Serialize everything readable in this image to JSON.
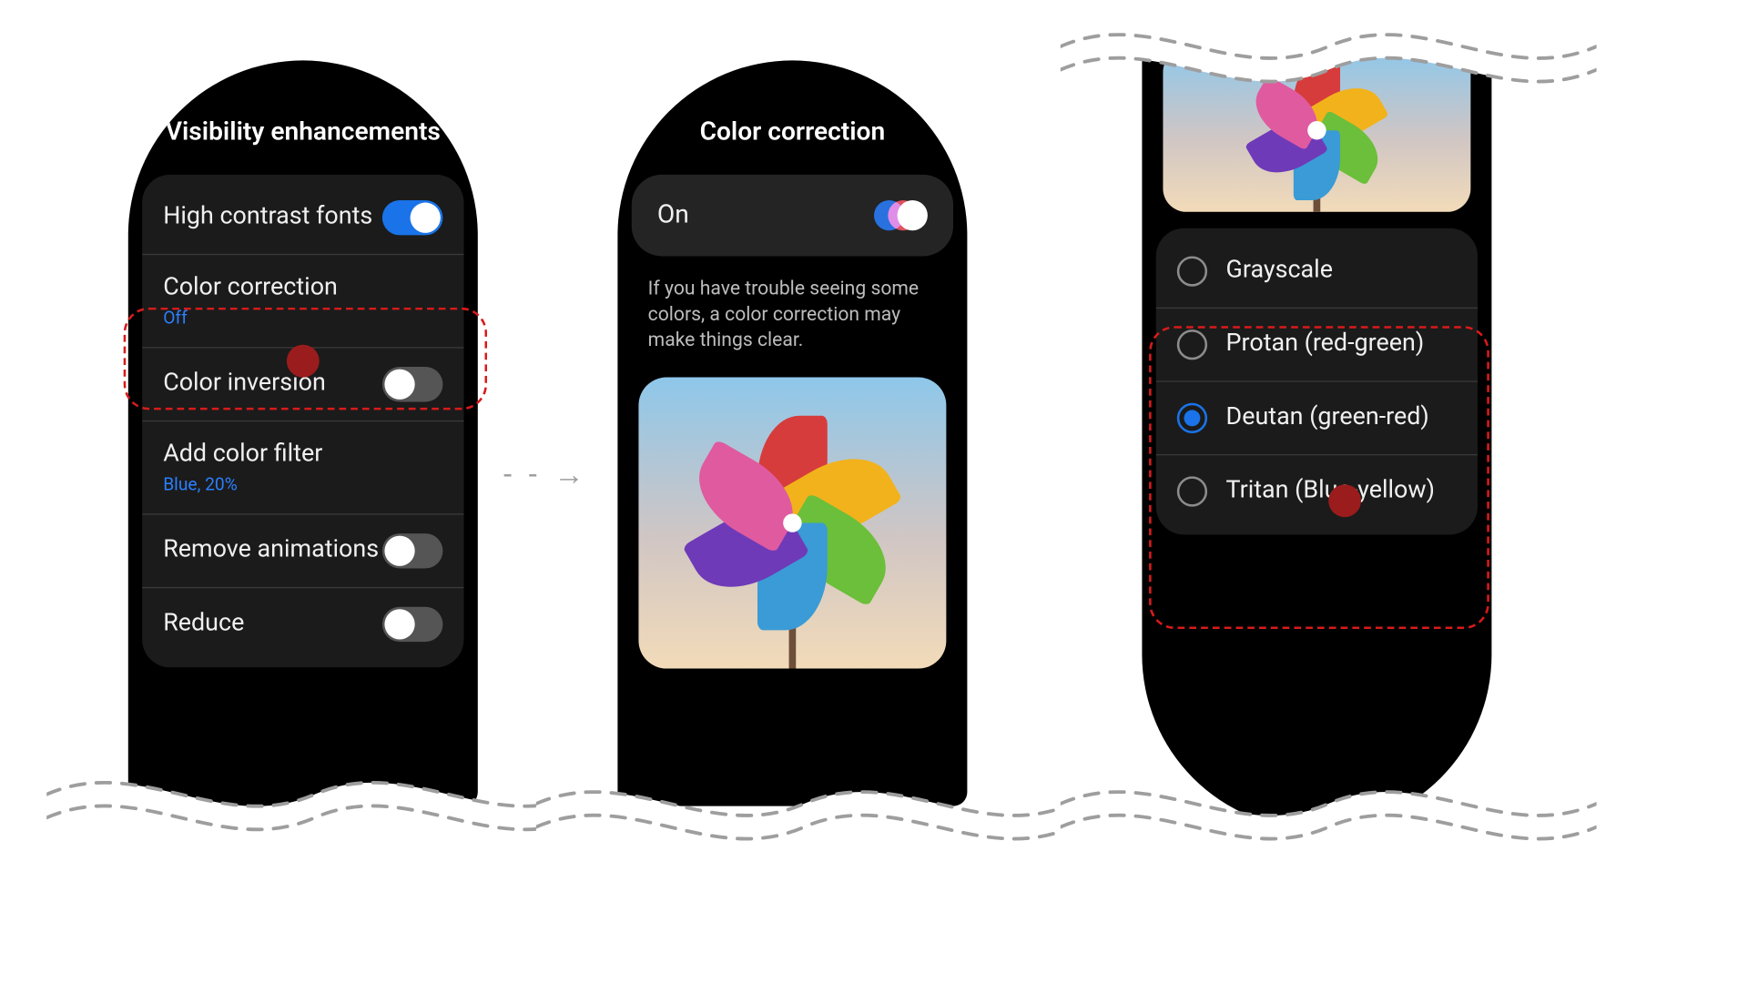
{
  "screen1": {
    "title": "Visibility enhancements",
    "items": [
      {
        "label": "High contrast fonts",
        "sub": "",
        "toggle": "on"
      },
      {
        "label": "Color correction",
        "sub": "Off"
      },
      {
        "label": "Color inversion",
        "sub": "",
        "toggle": "off"
      },
      {
        "label": "Add color filter",
        "sub": "Blue, 20%"
      },
      {
        "label": "Remove animations",
        "sub": "",
        "toggle": "off"
      },
      {
        "label": "Reduce",
        "sub": "",
        "toggle": "off"
      }
    ]
  },
  "screen2": {
    "title": "Color correction",
    "on_label": "On",
    "description": "If you have trouble seeing some colors, a color correction may make things clear."
  },
  "screen3": {
    "options": [
      {
        "label": "Grayscale",
        "selected": false
      },
      {
        "label": "Protan (red-green)",
        "selected": false
      },
      {
        "label": "Deutan (green-red)",
        "selected": true
      },
      {
        "label": "Tritan (Blue-yellow)",
        "selected": false
      }
    ]
  }
}
